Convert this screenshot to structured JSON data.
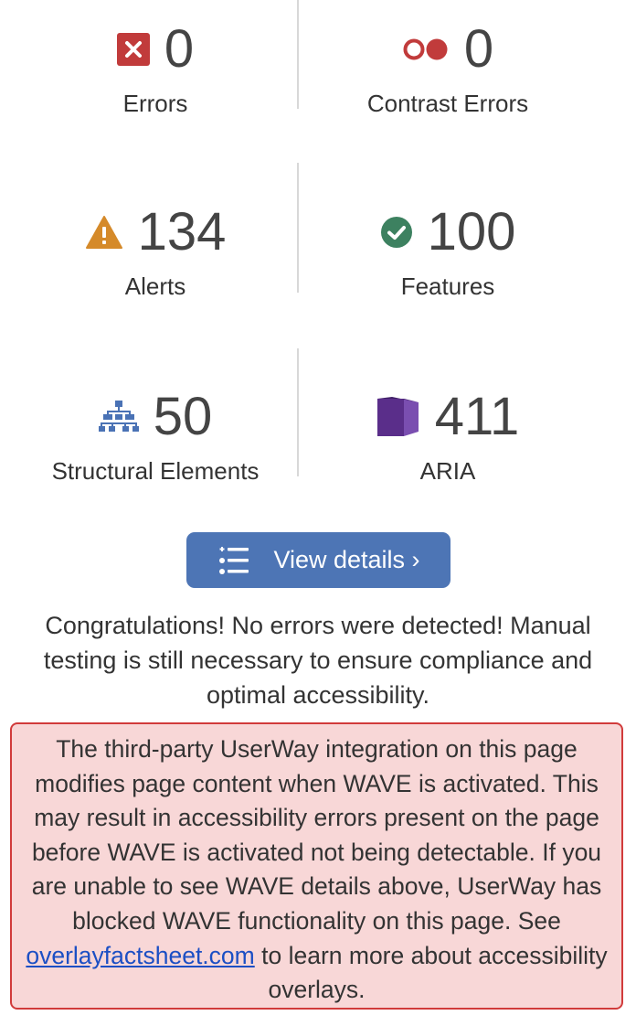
{
  "stats": {
    "errors": {
      "value": "0",
      "label": "Errors",
      "icon": "error-x-icon",
      "color": "#c13b3b"
    },
    "contrast_errors": {
      "value": "0",
      "label": "Contrast Errors",
      "icon": "contrast-circles-icon",
      "color": "#c13b3b"
    },
    "alerts": {
      "value": "134",
      "label": "Alerts",
      "icon": "alert-triangle-icon",
      "color": "#d58a2a"
    },
    "features": {
      "value": "100",
      "label": "Features",
      "icon": "checkmark-circle-icon",
      "color": "#3d8160"
    },
    "structural": {
      "value": "50",
      "label": "Structural Elements",
      "icon": "hierarchy-icon",
      "color": "#4a72b5"
    },
    "aria": {
      "value": "411",
      "label": "ARIA",
      "icon": "aria-box-icon",
      "color": "#5a2e8a"
    }
  },
  "view_details": {
    "label": "View details ›",
    "icon": "list-icon",
    "color": "#4d75b5"
  },
  "congrats_text": "Congratulations! No errors were detected! Manual testing is still necessary to ensure compliance and optimal accessibility.",
  "warning": {
    "text_before": "The third-party UserWay integration on this page modifies page content when WAVE is activated. This may result in accessibility errors present on the page before WAVE is activated not being detectable. If you are unable to see WAVE details above, UserWay has blocked WAVE functionality on this page. See ",
    "link_text": "overlayfactsheet.com",
    "text_after": " to learn more about accessibility overlays.",
    "background": "#f8d7d7",
    "border": "#d13b3b"
  }
}
